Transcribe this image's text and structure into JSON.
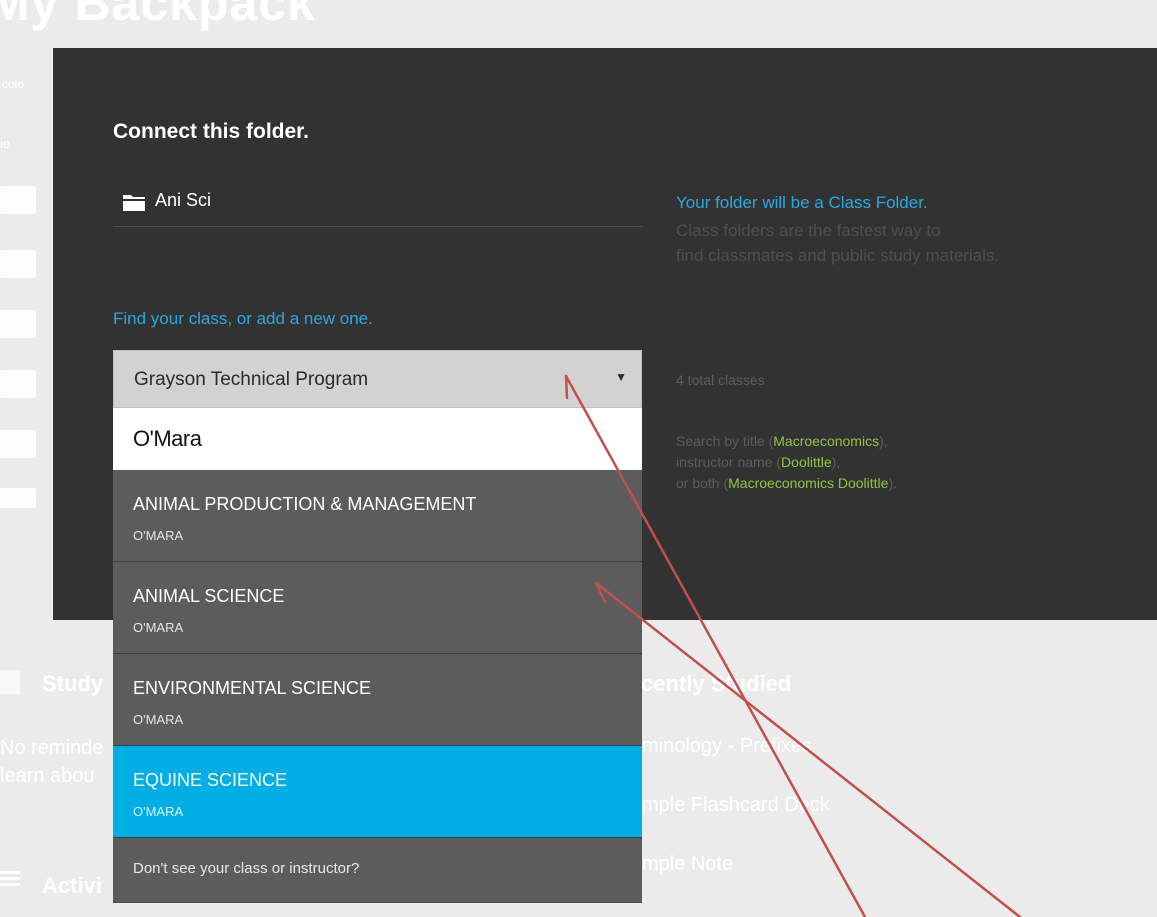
{
  "background": {
    "page_title": "My Backpack",
    "side_label": "colo",
    "side_dropdown": "ie",
    "study_heading": "Study",
    "study_lines": [
      "No reminde",
      "learn abou"
    ],
    "recent_heading": "cently Studied",
    "recent_items": [
      "minology - Prefixes",
      "mple Flashcard Deck",
      "mple Note"
    ],
    "activity_heading": "Activi"
  },
  "modal": {
    "title": "Connect this folder.",
    "folder_name": "Ani Sci",
    "info_heading": "Your folder will be a Class Folder.",
    "info_line_1": "Class folders are the fastest way to",
    "info_line_2": "find classmates and public study materials.",
    "find_label": "Find your class, or add a new one.",
    "total_classes": "4 total classes",
    "hint": {
      "prefix_1": "Search by title (",
      "example_1": "Macroeconomics",
      "suffix_1": "),",
      "prefix_2": "instructor name (",
      "example_2": "Doolittle",
      "suffix_2": "),",
      "prefix_3": "or both (",
      "example_3": "Macroeconomics Doolittle",
      "suffix_3": ")."
    }
  },
  "dropdown": {
    "school": "Grayson Technical Program",
    "search_value": "O'Mara",
    "results": [
      {
        "title": "ANIMAL PRODUCTION & MANAGEMENT",
        "instructor": "O'MARA"
      },
      {
        "title": "ANIMAL SCIENCE",
        "instructor": "O'MARA"
      },
      {
        "title": "ENVIRONMENTAL SCIENCE",
        "instructor": "O'MARA"
      },
      {
        "title": "EQUINE SCIENCE",
        "instructor": "O'MARA"
      }
    ],
    "footer": "Don't see your class or instructor?"
  },
  "colors": {
    "modal_bg": "#323232",
    "accent_blue": "#29a8e0",
    "highlight_green": "#8cc63f",
    "active_result": "#00aee6",
    "annotation_arrow": "#c0504d"
  }
}
